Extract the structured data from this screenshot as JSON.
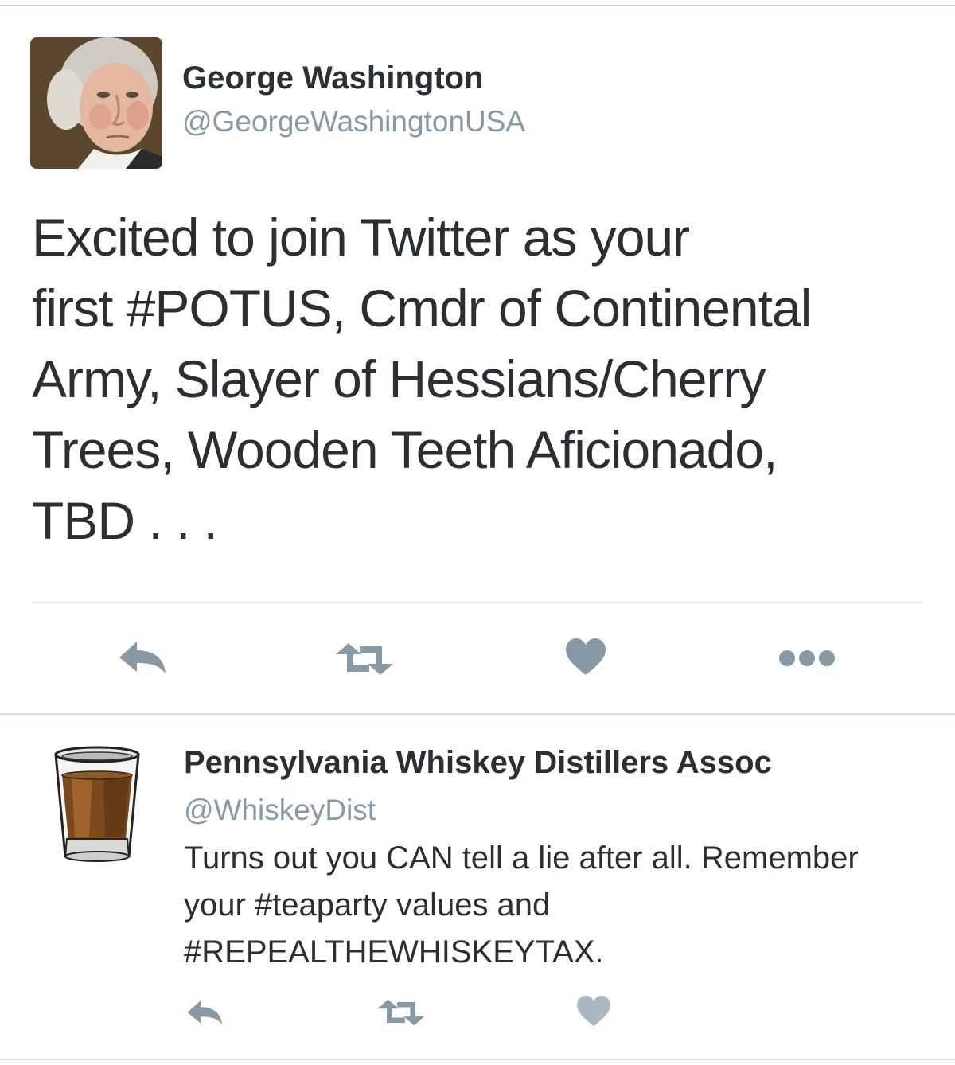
{
  "tweet": {
    "author_name": "George Washington",
    "author_handle": "@GeorgeWashingtonUSA",
    "text_lines": [
      "Excited to join Twitter as your",
      "first #POTUS, Cmdr of Continental",
      "Army, Slayer of Hessians/Cherry",
      "Trees, Wooden Teeth Aficionado,",
      "TBD  . . ."
    ],
    "actions": {
      "reply_icon": "reply-icon",
      "retweet_icon": "retweet-icon",
      "like_icon": "heart-icon",
      "more_icon": "more-dots-icon"
    }
  },
  "reply": {
    "author_name": "Pennsylvania Whiskey Distillers Assoc",
    "author_handle": "@WhiskeyDist",
    "text_lines": [
      "Turns out you CAN tell a lie after all. Remember",
      "your #teaparty values and",
      "#REPEALTHEWHISKEYTAX."
    ],
    "actions": {
      "reply_icon": "reply-icon",
      "retweet_icon": "retweet-icon",
      "like_icon": "heart-icon"
    }
  },
  "colors": {
    "text": "#292f33",
    "handle": "#8899a6",
    "icon": "#8899a6",
    "rule": "#e1e8ed"
  }
}
